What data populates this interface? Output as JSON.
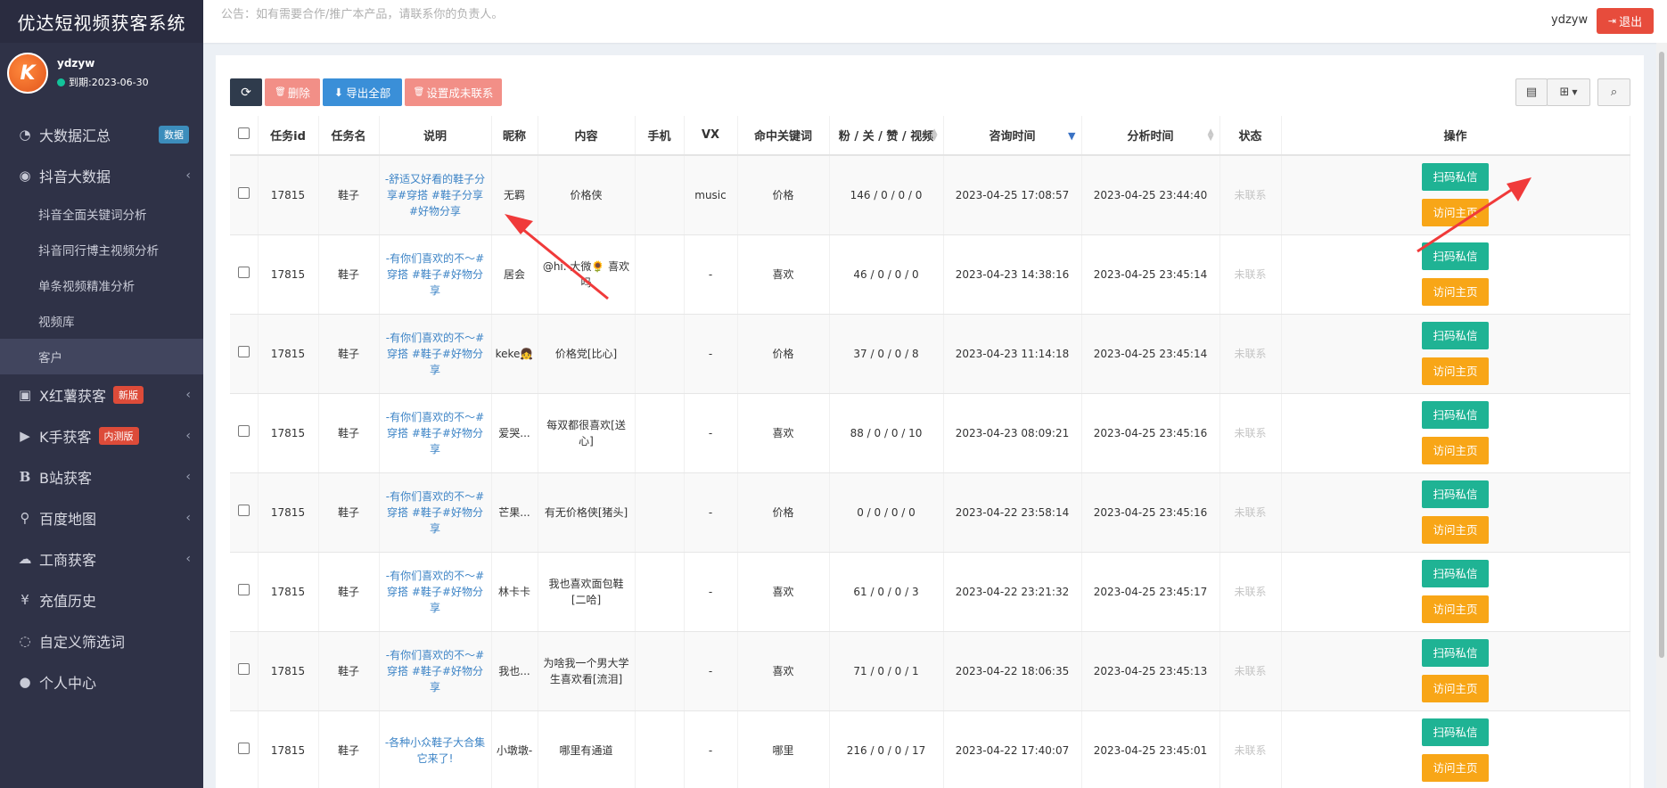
{
  "sidebar": {
    "brand": "优达短视频获客系统",
    "user": {
      "name": "ydzyw",
      "expire": "到期:2023-06-30",
      "avatar_text": "K"
    },
    "menu": [
      {
        "label": "大数据汇总",
        "icon": "dashboard-icon",
        "badge": "数据"
      },
      {
        "label": "抖音大数据",
        "icon": "eye-icon"
      },
      {
        "label": "X红薯获客",
        "icon": "book-icon",
        "badge": "新版"
      },
      {
        "label": "K手获客",
        "icon": "play-circle-icon",
        "badge": "内测版"
      },
      {
        "label": "B站获客",
        "icon": "b-letter-icon"
      },
      {
        "label": "百度地图",
        "icon": "map-marker-icon"
      },
      {
        "label": "工商获客",
        "icon": "cloud-icon"
      },
      {
        "label": "充值历史",
        "icon": "yen-icon"
      },
      {
        "label": "自定义筛选词",
        "icon": "rss-icon"
      },
      {
        "label": "个人中心",
        "icon": "user-icon"
      }
    ],
    "submenu": [
      {
        "label": "抖音全面关键词分析"
      },
      {
        "label": "抖音同行博主视频分析"
      },
      {
        "label": "单条视频精准分析"
      },
      {
        "label": "视频库"
      },
      {
        "label": "客户"
      }
    ]
  },
  "topbar": {
    "announcement": "公告：如有需要合作/推广本产品，请联系你的负责人。",
    "username": "ydzyw",
    "logout": "退出"
  },
  "toolbar": {
    "delete": "删除",
    "export_all": "导出全部",
    "set_uncontacted": "设置成未联系"
  },
  "table": {
    "headers": [
      "任务id",
      "任务名",
      "说明",
      "昵称",
      "内容",
      "手机",
      "VX",
      "命中关键词",
      "粉 / 关 / 赞 / 视频",
      "咨询时间",
      "分析时间",
      "状态",
      "操作"
    ],
    "scan_label": "扫码私信",
    "visit_label": "访问主页",
    "rows": [
      {
        "id": "17815",
        "task": "鞋子",
        "desc": "-舒适又好看的鞋子分享#穿搭 #鞋子分享 #好物分享",
        "nick": "无羁",
        "content": "价格侠",
        "phone": "",
        "vx": "music",
        "keyword": "价格",
        "stats": "146 / 0 / 0 / 0",
        "consult": "2023-04-25 17:08:57",
        "analysis": "2023-04-25 23:44:40",
        "status": "未联系"
      },
      {
        "id": "17815",
        "task": "鞋子",
        "desc": "-有你们喜欢的不～#穿搭 #鞋子#好物分享",
        "nick": "居会",
        "content": "@hi. 大微🌻 喜欢吗",
        "phone": "",
        "vx": "-",
        "keyword": "喜欢",
        "stats": "46 / 0 / 0 / 0",
        "consult": "2023-04-23 14:38:16",
        "analysis": "2023-04-25 23:45:14",
        "status": "未联系"
      },
      {
        "id": "17815",
        "task": "鞋子",
        "desc": "-有你们喜欢的不～#穿搭 #鞋子#好物分享",
        "nick": "keke👧",
        "content": "价格党[比心]",
        "phone": "",
        "vx": "-",
        "keyword": "价格",
        "stats": "37 / 0 / 0 / 8",
        "consult": "2023-04-23 11:14:18",
        "analysis": "2023-04-25 23:45:14",
        "status": "未联系"
      },
      {
        "id": "17815",
        "task": "鞋子",
        "desc": "-有你们喜欢的不～#穿搭 #鞋子#好物分享",
        "nick": "爱哭...",
        "content": "每双都很喜欢[送心]",
        "phone": "",
        "vx": "-",
        "keyword": "喜欢",
        "stats": "88 / 0 / 0 / 10",
        "consult": "2023-04-23 08:09:21",
        "analysis": "2023-04-25 23:45:16",
        "status": "未联系"
      },
      {
        "id": "17815",
        "task": "鞋子",
        "desc": "-有你们喜欢的不～#穿搭 #鞋子#好物分享",
        "nick": "芒果...",
        "content": "有无价格侠[猪头]",
        "phone": "",
        "vx": "-",
        "keyword": "价格",
        "stats": "0 / 0 / 0 / 0",
        "consult": "2023-04-22 23:58:14",
        "analysis": "2023-04-25 23:45:16",
        "status": "未联系"
      },
      {
        "id": "17815",
        "task": "鞋子",
        "desc": "-有你们喜欢的不～#穿搭 #鞋子#好物分享",
        "nick": "林卡卡",
        "content": "我也喜欢面包鞋[二哈]",
        "phone": "",
        "vx": "-",
        "keyword": "喜欢",
        "stats": "61 / 0 / 0 / 3",
        "consult": "2023-04-22 23:21:32",
        "analysis": "2023-04-25 23:45:17",
        "status": "未联系"
      },
      {
        "id": "17815",
        "task": "鞋子",
        "desc": "-有你们喜欢的不～#穿搭 #鞋子#好物分享",
        "nick": "我也...",
        "content": "为啥我一个男大学生喜欢看[流泪]",
        "phone": "",
        "vx": "-",
        "keyword": "喜欢",
        "stats": "71 / 0 / 0 / 1",
        "consult": "2023-04-22 18:06:35",
        "analysis": "2023-04-25 23:45:13",
        "status": "未联系"
      },
      {
        "id": "17815",
        "task": "鞋子",
        "desc": "-各种小众鞋子大合集它来了!",
        "nick": "小墩墩-",
        "content": "哪里有通道",
        "phone": "",
        "vx": "-",
        "keyword": "哪里",
        "stats": "216 / 0 / 0 / 17",
        "consult": "2023-04-22 17:40:07",
        "analysis": "2023-04-25 23:45:01",
        "status": "未联系"
      }
    ]
  },
  "colors": {
    "sidebar": "#2f3247",
    "scan": "#1fb394",
    "visit": "#f8a617",
    "logout": "#e74c3c",
    "arrow": "#f03a3a"
  }
}
